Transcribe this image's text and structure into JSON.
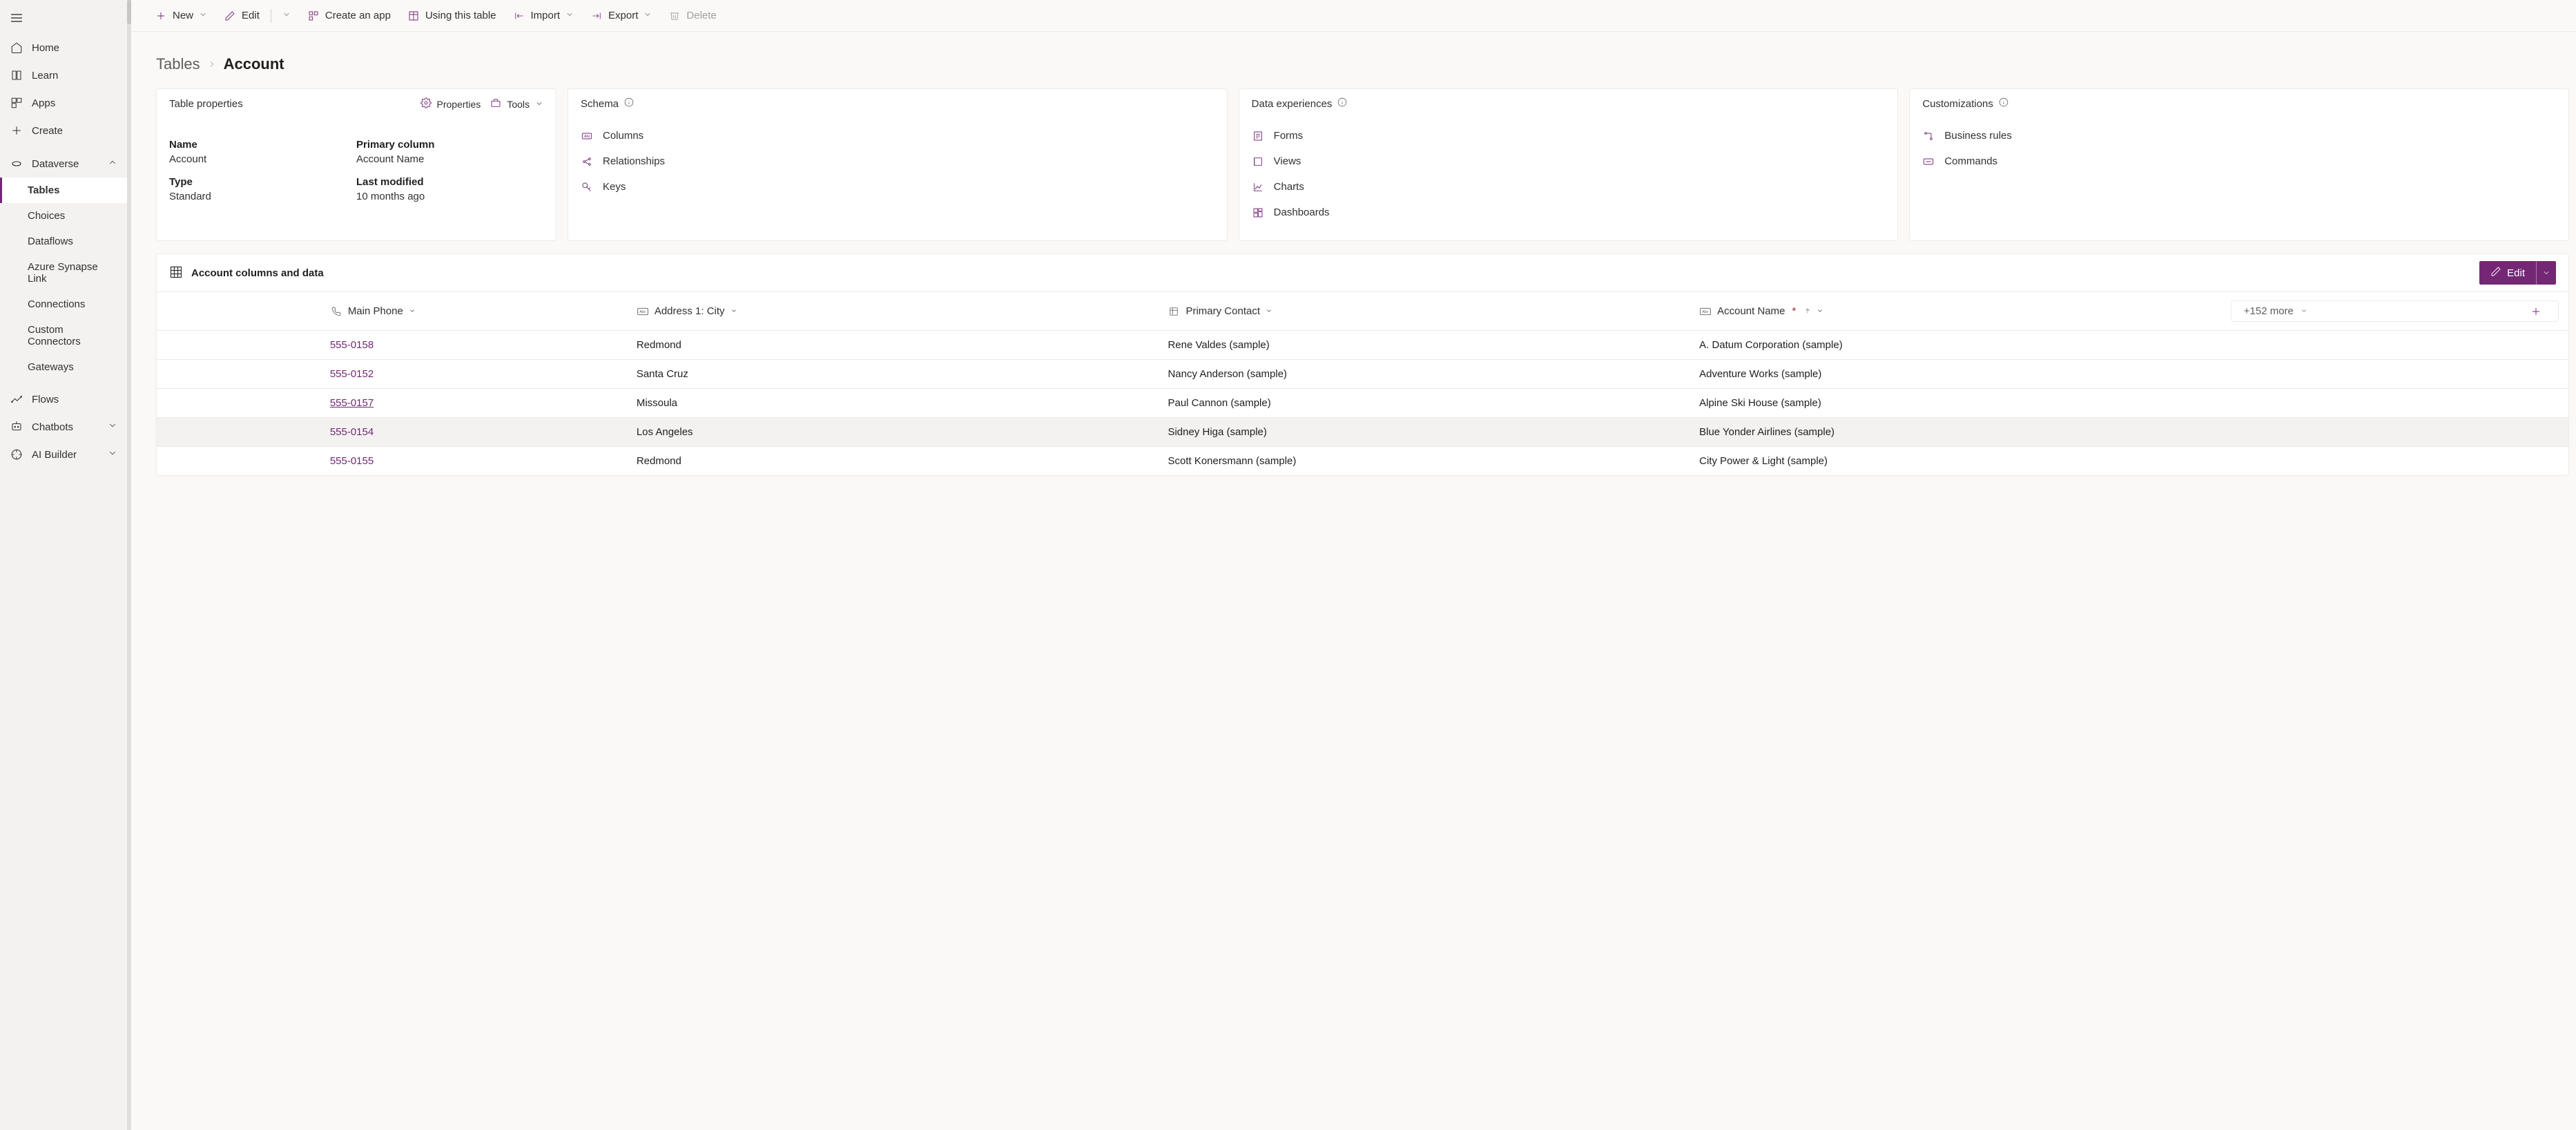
{
  "sidebar": {
    "items": [
      {
        "label": "Home",
        "icon": "home"
      },
      {
        "label": "Learn",
        "icon": "book"
      },
      {
        "label": "Apps",
        "icon": "apps"
      },
      {
        "label": "Create",
        "icon": "plus"
      },
      {
        "label": "Dataverse",
        "icon": "dataverse",
        "expandable": true,
        "expanded": true
      },
      {
        "label": "Tables",
        "sub": true,
        "selected": true
      },
      {
        "label": "Choices",
        "sub": true
      },
      {
        "label": "Dataflows",
        "sub": true
      },
      {
        "label": "Azure Synapse Link",
        "sub": true
      },
      {
        "label": "Connections",
        "sub": true
      },
      {
        "label": "Custom Connectors",
        "sub": true
      },
      {
        "label": "Gateways",
        "sub": true
      },
      {
        "label": "Flows",
        "icon": "flow"
      },
      {
        "label": "Chatbots",
        "icon": "chatbot",
        "expandable": true
      },
      {
        "label": "AI Builder",
        "icon": "ai",
        "expandable": true
      }
    ]
  },
  "cmdbar": {
    "new": "New",
    "edit": "Edit",
    "create_app": "Create an app",
    "using_table": "Using this table",
    "import": "Import",
    "export": "Export",
    "delete": "Delete"
  },
  "breadcrumb": {
    "parent": "Tables",
    "current": "Account"
  },
  "props_card": {
    "title": "Table properties",
    "properties_btn": "Properties",
    "tools_btn": "Tools",
    "name_lbl": "Name",
    "name_val": "Account",
    "type_lbl": "Type",
    "type_val": "Standard",
    "primary_lbl": "Primary column",
    "primary_val": "Account Name",
    "modified_lbl": "Last modified",
    "modified_val": "10 months ago"
  },
  "schema_card": {
    "title": "Schema",
    "columns": "Columns",
    "relationships": "Relationships",
    "keys": "Keys"
  },
  "exp_card": {
    "title": "Data experiences",
    "forms": "Forms",
    "views": "Views",
    "charts": "Charts",
    "dashboards": "Dashboards"
  },
  "custom_card": {
    "title": "Customizations",
    "rules": "Business rules",
    "commands": "Commands"
  },
  "grid": {
    "title": "Account columns and data",
    "edit_btn": "Edit",
    "more_label": "+152 more",
    "cols": {
      "phone": "Main Phone",
      "city": "Address 1: City",
      "contact": "Primary Contact",
      "account": "Account Name"
    },
    "rows": [
      {
        "phone": "555-0158",
        "city": "Redmond",
        "contact": "Rene Valdes (sample)",
        "account": "A. Datum Corporation (sample)"
      },
      {
        "phone": "555-0152",
        "city": "Santa Cruz",
        "contact": "Nancy Anderson (sample)",
        "account": "Adventure Works (sample)"
      },
      {
        "phone": "555-0157",
        "city": "Missoula",
        "contact": "Paul Cannon (sample)",
        "account": "Alpine Ski House (sample)",
        "underline": true
      },
      {
        "phone": "555-0154",
        "city": "Los Angeles",
        "contact": "Sidney Higa (sample)",
        "account": "Blue Yonder Airlines (sample)",
        "hover": true
      },
      {
        "phone": "555-0155",
        "city": "Redmond",
        "contact": "Scott Konersmann (sample)",
        "account": "City Power & Light (sample)"
      }
    ]
  }
}
